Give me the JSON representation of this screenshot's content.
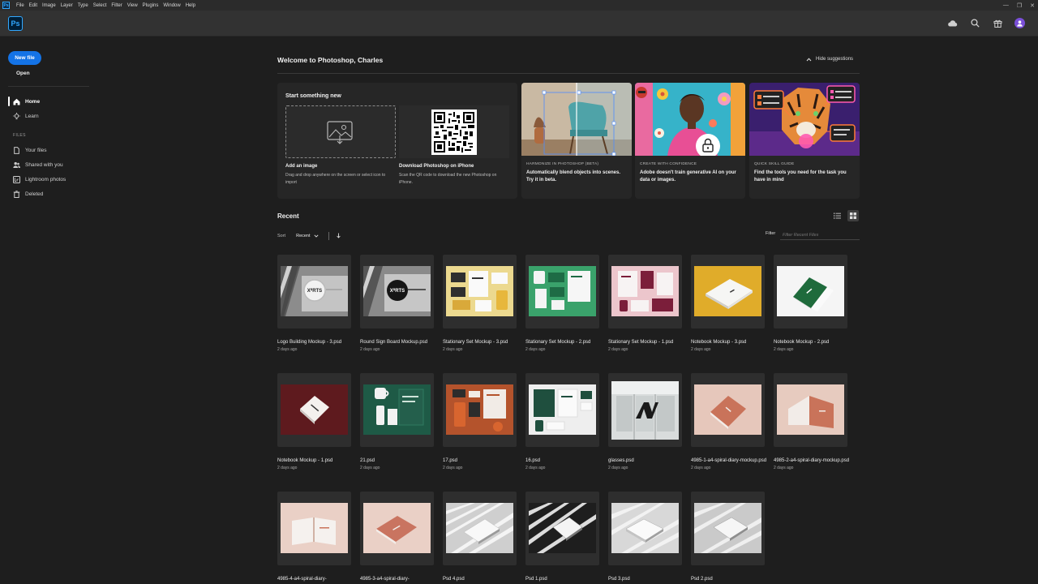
{
  "menu": [
    "File",
    "Edit",
    "Image",
    "Layer",
    "Type",
    "Select",
    "Filter",
    "View",
    "Plugins",
    "Window",
    "Help"
  ],
  "app": {
    "logo_text": "Ps",
    "mini_logo_text": "Ps"
  },
  "window_controls": {
    "minimize": "—",
    "maximize": "❐",
    "close": "✕"
  },
  "sidebar": {
    "new_file": "New file",
    "open": "Open",
    "nav": [
      {
        "label": "Home",
        "icon": "home-icon"
      },
      {
        "label": "Learn",
        "icon": "lightbulb-icon"
      }
    ],
    "files_heading": "FILES",
    "files": [
      {
        "label": "Your files",
        "icon": "file-icon"
      },
      {
        "label": "Shared with you",
        "icon": "people-icon"
      },
      {
        "label": "Lightroom photos",
        "icon": "lightroom-icon"
      },
      {
        "label": "Deleted",
        "icon": "trash-icon"
      }
    ]
  },
  "main": {
    "welcome": "Welcome to Photoshop, Charles",
    "hide_suggestions": "Hide suggestions",
    "start": {
      "title": "Start something new",
      "add_image_title": "Add an image",
      "add_image_desc": "Drag and drop anywhere on the screen or select icon to import",
      "download_title": "Download Photoshop on iPhone",
      "download_desc": "Scan the QR code to download the new Photoshop on iPhone."
    },
    "suggestions": [
      {
        "tag": "HARMONIZE IN PHOTOSHOP (BETA)",
        "desc": "Automatically blend objects into scenes. Try it in beta."
      },
      {
        "tag": "CREATE WITH CONFIDENCE",
        "desc": "Adobe doesn't train generative AI on your data or images."
      },
      {
        "tag": "QUICK SKILL GUIDE",
        "desc": "Find the tools you need for the task you have in mind"
      }
    ],
    "recent": {
      "title": "Recent",
      "sort_label": "Sort",
      "sort_value": "Recent",
      "filter_label": "Filter",
      "filter_placeholder": "Filter Recent Files",
      "files": [
        {
          "name": "Logo Building Mockup - 3.psd",
          "date": "2 days ago"
        },
        {
          "name": "Round Sign Board Mockup.psd",
          "date": "2 days ago"
        },
        {
          "name": "Stationary Set Mockup - 3.psd",
          "date": "2 days ago"
        },
        {
          "name": "Stationary Set Mockup - 2.psd",
          "date": "2 days ago"
        },
        {
          "name": "Stationary Set Mockup - 1.psd",
          "date": "2 days ago"
        },
        {
          "name": "Notebook Mockup - 3.psd",
          "date": "2 days ago"
        },
        {
          "name": "Notebook Mockup - 2.psd",
          "date": "2 days ago"
        },
        {
          "name": "Notebook Mockup - 1.psd",
          "date": "2 days ago"
        },
        {
          "name": "21.psd",
          "date": "2 days ago"
        },
        {
          "name": "17.psd",
          "date": "2 days ago"
        },
        {
          "name": "16.psd",
          "date": "2 days ago"
        },
        {
          "name": "glasses.psd",
          "date": "2 days ago"
        },
        {
          "name": "4985-1-a4-spiral-diary-mockup.psd",
          "date": "2 days ago"
        },
        {
          "name": "4985-2-a4-spiral-diary-mockup.psd",
          "date": "2 days ago"
        },
        {
          "name": "4985-4-a4-spiral-diary-",
          "date": ""
        },
        {
          "name": "4985-3-a4-spiral-diary-",
          "date": ""
        },
        {
          "name": "Psd 4.psd",
          "date": ""
        },
        {
          "name": "Psd 1.psd",
          "date": ""
        },
        {
          "name": "Psd 3.psd",
          "date": ""
        },
        {
          "name": "Psd 2.psd",
          "date": ""
        }
      ]
    }
  },
  "colors": {
    "accent": "#1473e6",
    "background": "#1e1e1e",
    "ps_blue": "#31a8ff"
  }
}
